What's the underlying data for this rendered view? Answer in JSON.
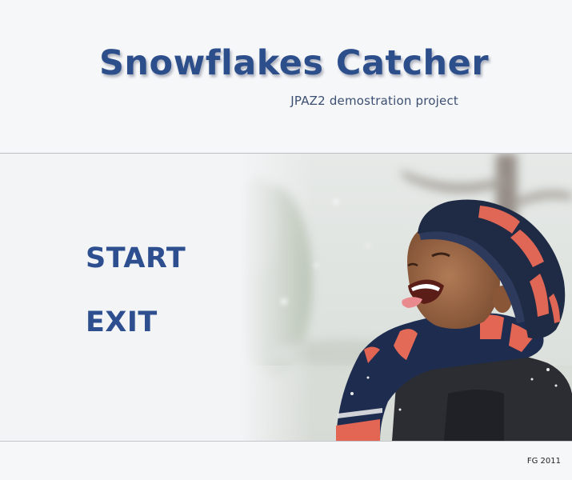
{
  "header": {
    "title": "Snowflakes Catcher",
    "subtitle": "JPAZ2 demostration project"
  },
  "menu": {
    "start_label": "START",
    "exit_label": "EXIT"
  },
  "footer": {
    "credit": "FG 2011"
  },
  "colors": {
    "title": "#2c4f8c",
    "menu": "#2e4f8f",
    "background": "#f5f6f8"
  }
}
